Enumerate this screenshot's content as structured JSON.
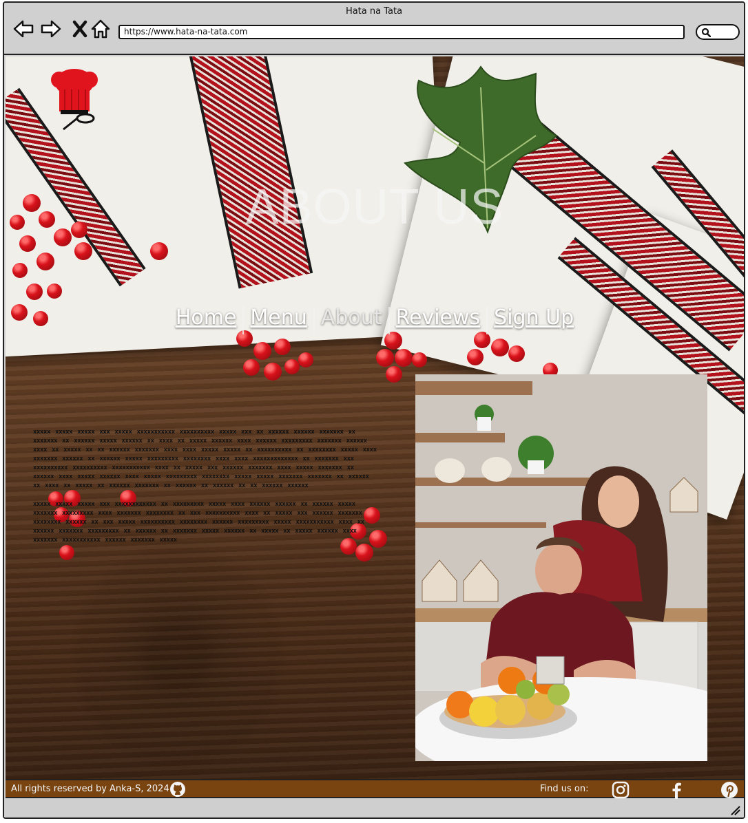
{
  "window": {
    "title": "Hata na Tata",
    "url": "https://www.hata-na-tata.com"
  },
  "brand": {
    "logo_text": "Hata na Tata"
  },
  "hero": {
    "title": "ABOUT US"
  },
  "nav": {
    "items": [
      {
        "label": "Home",
        "current": false
      },
      {
        "label": "Menu",
        "current": false
      },
      {
        "label": "About",
        "current": true
      },
      {
        "label": "Reviews",
        "current": false
      },
      {
        "label": "Sign Up",
        "current": false
      }
    ]
  },
  "about": {
    "paragraphs": [
      "xxxxx xxxxx xxxxx xxx xxxxx xxxxxxxxxxx xxxxxxxxxx xxxxx xxx xx xxxxxx xxxxxx xxxxxxx xx xxxxxxx xx xxxxxx xxxxx xxxxxx xx xxxx xx xxxxx xxxxxx xxxx xxxxxx xxxxxxxxx xxxxxxx xxxxxx xxxx xx xxxxx xx xx xxxxxx xxxxxxx xxxx xxxx xxxxx xxxxx xx xxxxxxxxxx xx xxxxxxxx xxxxx xxxx xxxxxxx xxxxxx xx xxxxxx xxxxx xxxxxxxxx xxxxxxxx xxxx xxxx xxxxxxxxxxxxx xx xxxxxxx xxx xxxxxxxxxx xxxxxxxxxx xxxxxxxxxxx xxxx xx xxxxx xxx xxxxxx xxxxxxx xxxx xxxxx xxxxxxx xx xxxxxx xxxx xxxxx xxxxxx xxxx xxxxx xxxxxxxxx xxxxxxxx xxxxx xxxxx xxxxxxx xxxxxxx xx xxxxxx xx xxxx xx xxxxx xx xxxxxx xxxxxxx xx xxxxxx xx xxxxxx xx xx xxxxxx xxxxxx",
      "xxxxx xxxxx xxxxx xxx xxxxxxxxxxxx xx xxxxxxxxx xxxxx xxxx xxxxxx xxxxxx xx xxxxxx xxxxx xxxxxxx xxxxxxxxx xxxx xxxxxxx xxxxxxxx xx xxx xxxxxxxxxx xxxx xx xxxxx xxx xxxxxx xxxxxxx xxxxxxxx xxxxxx xx xxx xxxxx xxxxxxxxxx xxxxxxxx xxxxxx xxxxxxxxx xxxxx xxxxxxxxxxx xxxx xx xxxxxx xxxxxxx xxxxxxxxx xx xxxxxx xx xxxxxxx xxxxx xxxxxx xx xxxxx xx xxxxx xxxxxx xxxx xxxxxxx xxxxxxxxxxx xxxxxx xxxxxxx xxxxx"
    ]
  },
  "footer": {
    "copyright": "All rights reserved by Anka-S, 2024",
    "find_us": "Find us on:",
    "social": [
      "instagram-icon",
      "facebook-icon",
      "pinterest-icon"
    ]
  },
  "colors": {
    "footer_bg": "#7a4411",
    "embroidery_red": "#b3121c",
    "cloth": "#f1efe9"
  }
}
